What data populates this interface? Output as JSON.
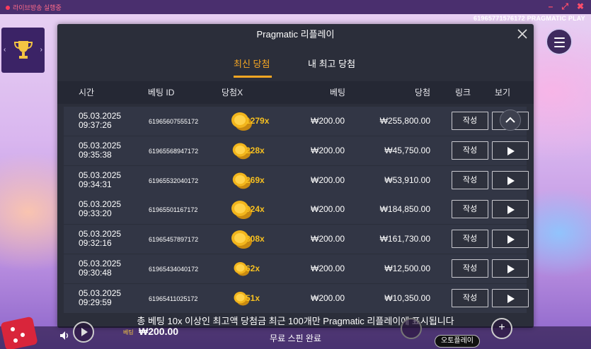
{
  "window": {
    "recording_label": "라이브방송 실행중",
    "player_id": "61965771576172 PRAGMATIC PLAY",
    "minimize_symbol": "–",
    "expand_symbol": "⤢",
    "close_symbol": "✖"
  },
  "modal": {
    "title": "Pragmatic 리플레이",
    "tabs": [
      {
        "label": "최신 당첨",
        "active": true
      },
      {
        "label": "내 최고 당첨",
        "active": false
      }
    ],
    "columns": {
      "time": "시간",
      "bet_id": "베팅 ID",
      "multiplier": "당첨X",
      "bet": "베팅",
      "win": "당첨",
      "link": "링크",
      "view": "보기"
    },
    "rows": [
      {
        "date": "05.03.2025",
        "time": "09:37:26",
        "bet_id": "61965607555172",
        "multiplier": "1279x",
        "bet": "₩200.00",
        "win": "₩255,800.00",
        "link_label": "작성",
        "coin_size": "large"
      },
      {
        "date": "05.03.2025",
        "time": "09:35:38",
        "bet_id": "61965568947172",
        "multiplier": "228x",
        "bet": "₩200.00",
        "win": "₩45,750.00",
        "link_label": "작성",
        "coin_size": "medium"
      },
      {
        "date": "05.03.2025",
        "time": "09:34:31",
        "bet_id": "61965532040172",
        "multiplier": "269x",
        "bet": "₩200.00",
        "win": "₩53,910.00",
        "link_label": "작성",
        "coin_size": "medium"
      },
      {
        "date": "05.03.2025",
        "time": "09:33:20",
        "bet_id": "61965501167172",
        "multiplier": "924x",
        "bet": "₩200.00",
        "win": "₩184,850.00",
        "link_label": "작성",
        "coin_size": "large"
      },
      {
        "date": "05.03.2025",
        "time": "09:32:16",
        "bet_id": "61965457897172",
        "multiplier": "808x",
        "bet": "₩200.00",
        "win": "₩161,730.00",
        "link_label": "작성",
        "coin_size": "large"
      },
      {
        "date": "05.03.2025",
        "time": "09:30:48",
        "bet_id": "61965434040172",
        "multiplier": "62x",
        "bet": "₩200.00",
        "win": "₩12,500.00",
        "link_label": "작성",
        "coin_size": "small"
      },
      {
        "date": "05.03.2025",
        "time": "09:29:59",
        "bet_id": "61965411025172",
        "multiplier": "51x",
        "bet": "₩200.00",
        "win": "₩10,350.00",
        "link_label": "작성",
        "coin_size": "small"
      }
    ]
  },
  "footer": {
    "notice": "총 베팅 10x 이상인 최고액 당첨금 최근 100개만 Pragmatic 리플레이에 표시됩니다",
    "bet_label": "베팅",
    "bet_value": "₩200.00",
    "status": "무료 스핀 완료",
    "autoplay_label": "오토플레이",
    "plus_symbol": "+"
  },
  "colors": {
    "accent": "#f5a623",
    "multiplier": "#f7c020",
    "modal_bg": "#2b2e3a",
    "row_bg": "#323645"
  }
}
